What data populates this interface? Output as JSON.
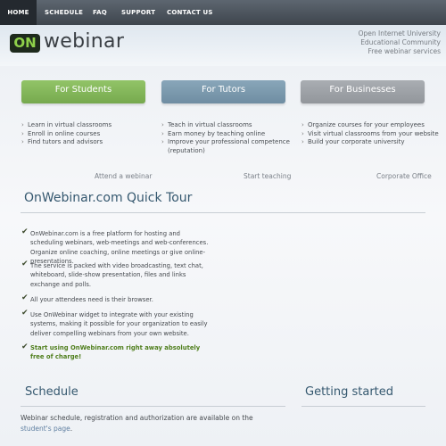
{
  "nav": {
    "items": [
      {
        "label": "HOME",
        "active": true
      },
      {
        "label": "SCHEDULE"
      },
      {
        "label": "FAQ"
      },
      {
        "label": "SUPPORT"
      },
      {
        "label": "CONTACT US"
      }
    ]
  },
  "header": {
    "logo_box": "ON",
    "logo_text": "webinar",
    "taglines": [
      "Open Internet University",
      "Educational Community",
      "Free webinar services"
    ]
  },
  "columns": [
    {
      "button": "For Students",
      "color": "#85bb5a",
      "items": [
        "Learn in virtual classrooms",
        "Enroll in online courses",
        "Find tutors and advisors"
      ],
      "link": "Attend a webinar"
    },
    {
      "button": "For Tutors",
      "color": "#7c9aae",
      "items": [
        "Teach in virtual classrooms",
        "Earn money by teaching online",
        "Improve your professional competence (reputation)"
      ],
      "link": "Start teaching"
    },
    {
      "button": "For Businesses",
      "color": "#9ea2a7",
      "items": [
        "Organize courses for your employees",
        "Visit virtual classrooms from your website",
        "Build your corporate university"
      ],
      "link": "Corporate Office"
    }
  ],
  "tour": {
    "title": "OnWebinar.com Quick Tour",
    "points": [
      "OnWebinar.com is a free platform for hosting and scheduling webinars, web-meetings and web-conferences. Organize online coaching, online meetings or give online-presentations.",
      "The service is packed with video broadcasting, text chat, whiteboard, slide-show presentation,  files and links exchange and polls.",
      "All your attendees need is their browser.",
      "Use OnWebinar widget to integrate with your existing systems, making it possible for your organization to easily deliver compelling webinars from your own website.",
      "Start using OnWebinar.com right away absolutely free of charge!"
    ]
  },
  "schedule": {
    "title": "Schedule",
    "text": "Webinar schedule, registration and authorization are available on the ",
    "link": "student's page",
    "text_end": "."
  },
  "getting_started": {
    "title": "Getting started"
  }
}
